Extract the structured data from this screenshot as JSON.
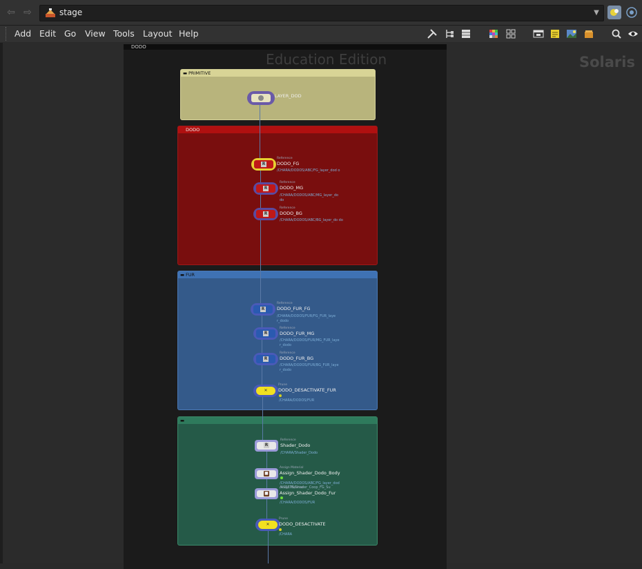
{
  "pathbar": {
    "path": "stage",
    "back_icon": "back-arrow-icon",
    "forward_icon": "forward-arrow-icon"
  },
  "menu": [
    "Add",
    "Edit",
    "Go",
    "View",
    "Tools",
    "Layout",
    "Help"
  ],
  "watermarks": {
    "education": "Education Edition",
    "context": "Solaris"
  },
  "network": {
    "outer_box": "DODO",
    "boxes": [
      {
        "title": "PRIMITIVE",
        "color": "#c8c487"
      },
      {
        "title": "DODO",
        "color": "#8b0f0f"
      },
      {
        "title": "FUR",
        "color": "#3a6aa6"
      },
      {
        "title": "",
        "color": "#2e6e58"
      }
    ],
    "nodes": [
      {
        "name": "LAYER_DOD",
        "type": "",
        "path": ""
      },
      {
        "name": "DODO_FG",
        "type": "Reference",
        "path": "/CHARA/DODOS/ABC/FG_layer_dod o"
      },
      {
        "name": "DODO_MG",
        "type": "Reference",
        "path": "/CHARA/DODOS/ABC/MG_layer_do do"
      },
      {
        "name": "DODO_BG",
        "type": "Reference",
        "path": "/CHARA/DODOS/ABC/BG_layer_do do"
      },
      {
        "name": "DODO_FUR_FG",
        "type": "Reference",
        "path": "/CHARA/DODOS/FUR/FG_FUR_laye r_dodo"
      },
      {
        "name": "DODO_FUR_MG",
        "type": "Reference",
        "path": "/CHARA/DODOS/FUR/MG_FUR_laye r_dodo"
      },
      {
        "name": "DODO_FUR_BG",
        "type": "Reference",
        "path": "/CHARA/DODOS/FUR/BG_FUR_laye r_dodo"
      },
      {
        "name": "DODO_DESACTIVATE_FUR",
        "type": "Prune",
        "path": "/CHARA/DODOS/FUR"
      },
      {
        "name": "Shader_Dodo",
        "type": "Reference",
        "path": "/CHARA/Shader_Dodo"
      },
      {
        "name": "Assign_Shader_Dodo_Body",
        "type": "Assign Material",
        "path": "/CHARA/DODOS/ABC/FG_layer_dod"
      },
      {
        "name": "Assign_Shader_Dodo_Fur",
        "type": "Assign Material",
        "path": "/CHARA/DODOS/FUR"
      },
      {
        "name": "DODO_DESACTIVATE",
        "type": "Prune",
        "path": "/CHARA"
      }
    ],
    "overlap_path": "/ASSETS/Shader_Coop_FG_Su"
  }
}
